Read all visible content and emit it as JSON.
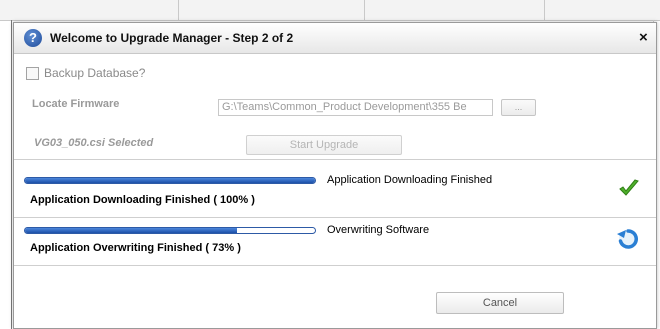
{
  "dialog": {
    "title": "Welcome to Upgrade Manager - Step 2 of 2",
    "help_icon": "question-mark-icon",
    "close_icon": "close-x-icon",
    "close_glyph": "×"
  },
  "backup": {
    "label": "Backup Database?",
    "checked": false
  },
  "firmware": {
    "label": "Locate Firmware",
    "path_value": "G:\\Teams\\Common_Product Development\\355 Be",
    "browse_label": "...",
    "selected_label": "VG03_050.csi Selected",
    "start_button_label": "Start Upgrade"
  },
  "progress": [
    {
      "status": "Application Downloading Finished ( 100% )",
      "message": "Application Downloading Finished",
      "percent": 100,
      "icon": "check-icon"
    },
    {
      "status": "Application Overwriting Finished ( 73% )",
      "message": "Overwriting Software",
      "percent": 73,
      "icon": "refresh-icon"
    }
  ],
  "footer": {
    "cancel_label": "Cancel"
  },
  "colors": {
    "progress_fill": "#1c4fa8",
    "check_green": "#4fb02b",
    "refresh_blue": "#2a7fd4"
  }
}
